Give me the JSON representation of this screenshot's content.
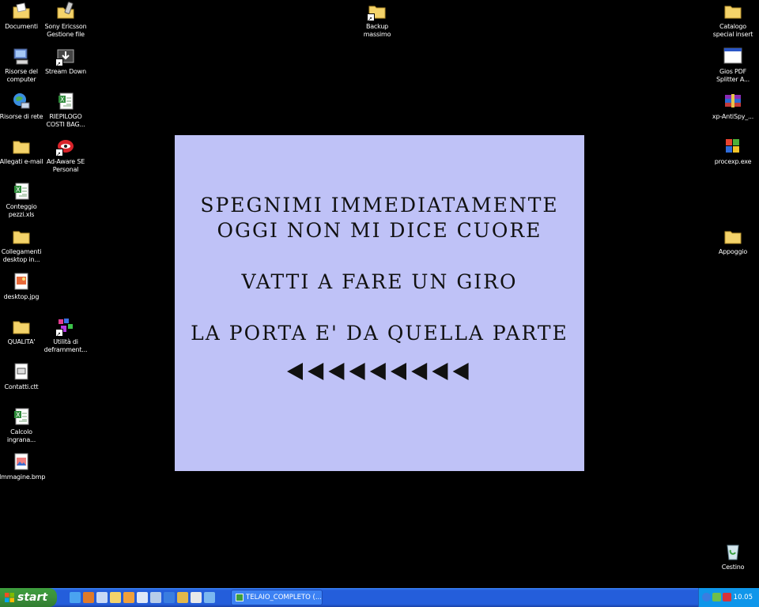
{
  "desktop": {
    "icons_left_col1": [
      {
        "label": [
          "Documenti"
        ],
        "icon": "documents-folder-icon"
      },
      {
        "label": [
          "Risorse del",
          "computer"
        ],
        "icon": "my-computer-icon"
      },
      {
        "label": [
          "Risorse di rete"
        ],
        "icon": "network-icon"
      },
      {
        "label": [
          "Allegati e-mail"
        ],
        "icon": "folder-icon"
      },
      {
        "label": [
          "Conteggio",
          "pezzi.xls"
        ],
        "icon": "excel-file-icon"
      },
      {
        "label": [
          "Collegamenti",
          "desktop in..."
        ],
        "icon": "folder-icon"
      },
      {
        "label": [
          "desktop.jpg"
        ],
        "icon": "image-file-icon"
      },
      {
        "label": [
          "QUALITA'"
        ],
        "icon": "folder-icon"
      },
      {
        "label": [
          "Contatti.ctt"
        ],
        "icon": "contacts-file-icon"
      },
      {
        "label": [
          "Calcolo",
          "ingrana..."
        ],
        "icon": "excel-file-icon"
      },
      {
        "label": [
          "Immagine.bmp"
        ],
        "icon": "bitmap-file-icon"
      }
    ],
    "icons_left_col2": [
      {
        "label": [
          "Sony Ericsson",
          "Gestione file"
        ],
        "icon": "phone-folder-icon"
      },
      {
        "label": [
          "Stream Down"
        ],
        "icon": "download-app-icon"
      },
      {
        "label": [
          "RIEPILOGO",
          "COSTI BAG..."
        ],
        "icon": "excel-file-icon"
      },
      {
        "label": [
          "Ad-Aware SE",
          "Personal"
        ],
        "icon": "ad-aware-icon"
      },
      {
        "label": [
          "Utilità di",
          "deframment..."
        ],
        "icon": "defrag-icon"
      }
    ],
    "icon_center": {
      "label": [
        "Backup",
        "massimo"
      ],
      "icon": "folder-shortcut-icon"
    },
    "icons_right": [
      {
        "label": [
          "Catalogo",
          "special insert"
        ],
        "icon": "folder-icon"
      },
      {
        "label": [
          "Gios PDF",
          "Splitter A..."
        ],
        "icon": "app-window-icon"
      },
      {
        "label": [
          "xp-AntiSpy_..."
        ],
        "icon": "winrar-archive-icon"
      },
      {
        "label": [
          "procexp.exe"
        ],
        "icon": "windows-logo-icon"
      },
      {
        "label": [
          "Appoggio"
        ],
        "icon": "folder-icon"
      },
      {
        "label": [
          "Cestino"
        ],
        "icon": "recycle-bin-icon"
      }
    ]
  },
  "panel": {
    "line1": "SPEGNIMI IMMEDIATAMENTE",
    "line2": "OGGI NON MI DICE CUORE",
    "line3": "VATTI A FARE UN GIRO",
    "line4": "LA PORTA E' DA QUELLA PARTE",
    "arrow_count": 9,
    "background": "#bfc2f7"
  },
  "taskbar": {
    "start_label": "start",
    "task_label": "TELAIO_COMPLETO (...",
    "clock": "10.05",
    "accent": "#245edb",
    "start_color": "#3c8f3c"
  }
}
